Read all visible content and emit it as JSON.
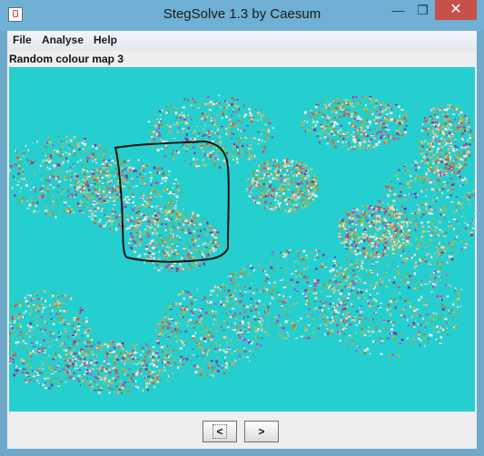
{
  "window": {
    "title": "StegSolve 1.3 by Caesum",
    "controls": {
      "minimize": "—",
      "maximize": "❐",
      "close": "✕"
    }
  },
  "menu": {
    "file": "File",
    "analyse": "Analyse",
    "help": "Help"
  },
  "view_label": "Random colour map 3",
  "nav": {
    "prev": "<",
    "next": ">"
  },
  "colors": {
    "image_background": "#25cfcf",
    "title_bar": "#6fb0d4",
    "close_button": "#c7504a"
  }
}
